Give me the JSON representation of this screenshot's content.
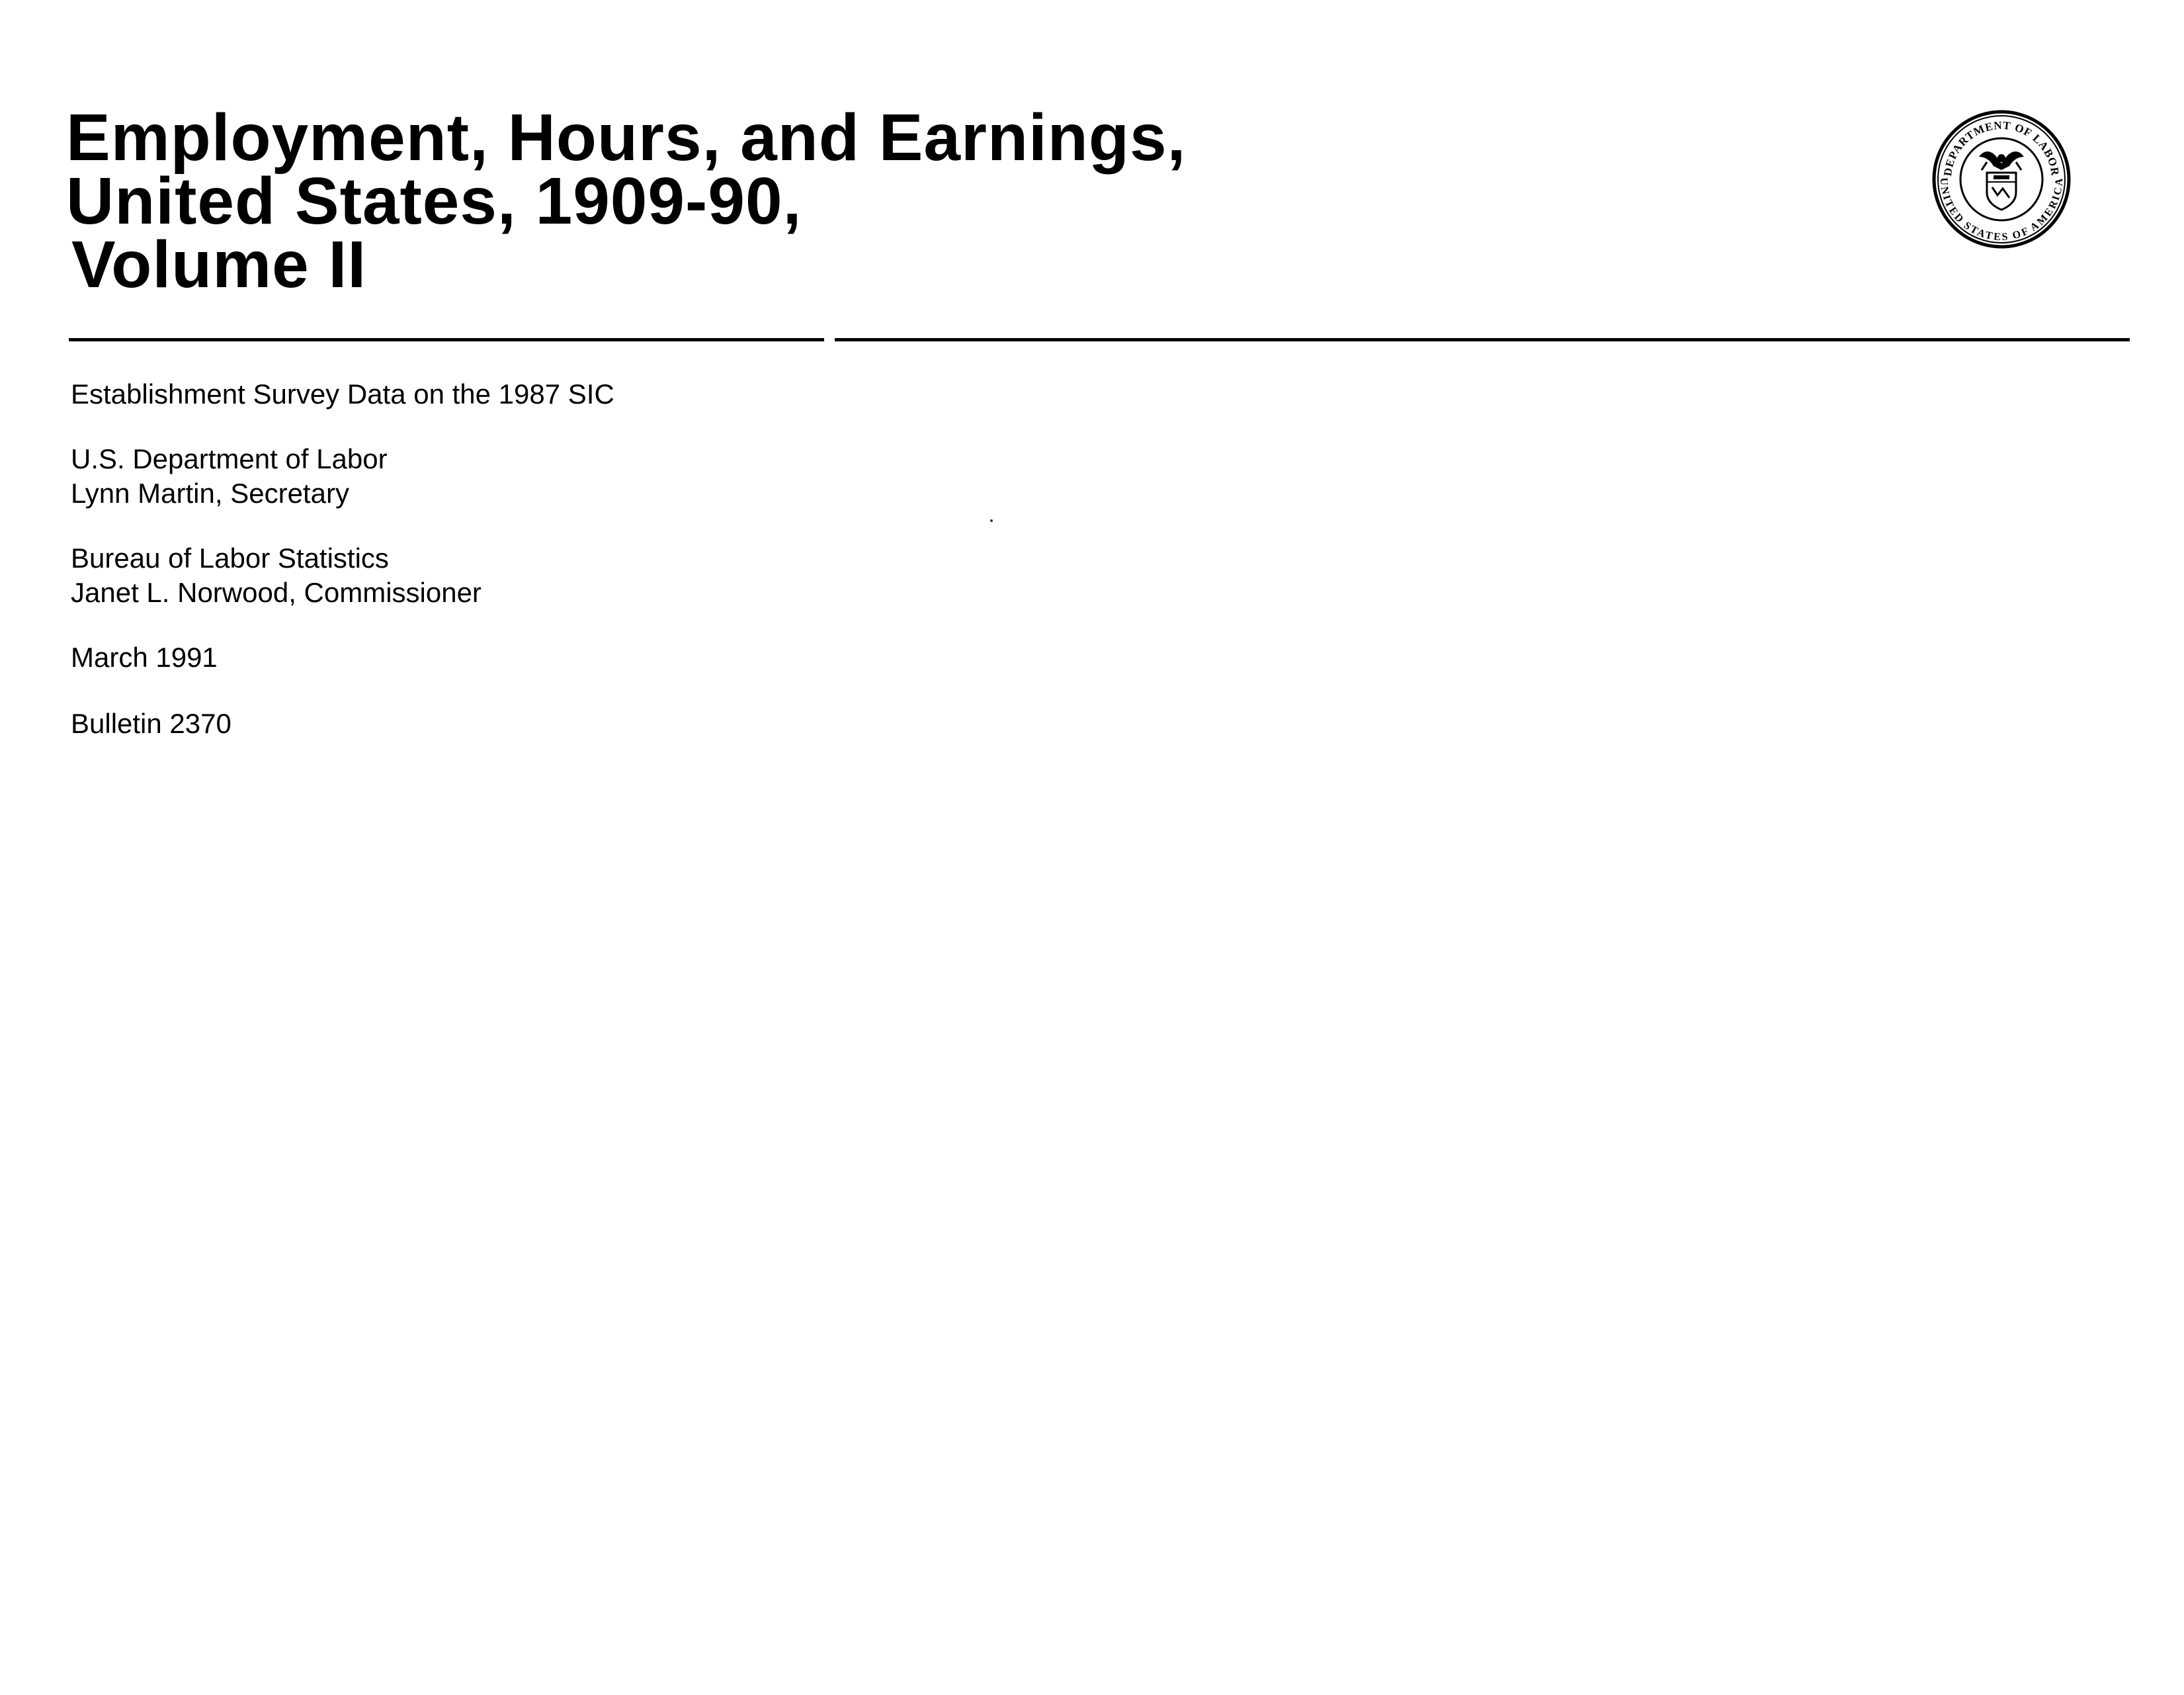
{
  "title": {
    "line1": "Employment, Hours, and Earnings,",
    "line2": "United States, 1909-90,",
    "line3": "Volume II"
  },
  "seal": {
    "icon": "department-of-labor-seal-icon",
    "top_text": "DEPARTMENT OF LABOR",
    "bottom_text": "UNITED STATES OF AMERICA"
  },
  "subtitle": "Establishment Survey Data on the 1987 SIC",
  "department": {
    "name": "U.S. Department of Labor",
    "head": "Lynn Martin, Secretary"
  },
  "bureau": {
    "name": "Bureau of Labor Statistics",
    "head": "Janet L. Norwood, Commissioner"
  },
  "date": "March 1991",
  "bulletin": "Bulletin 2370"
}
